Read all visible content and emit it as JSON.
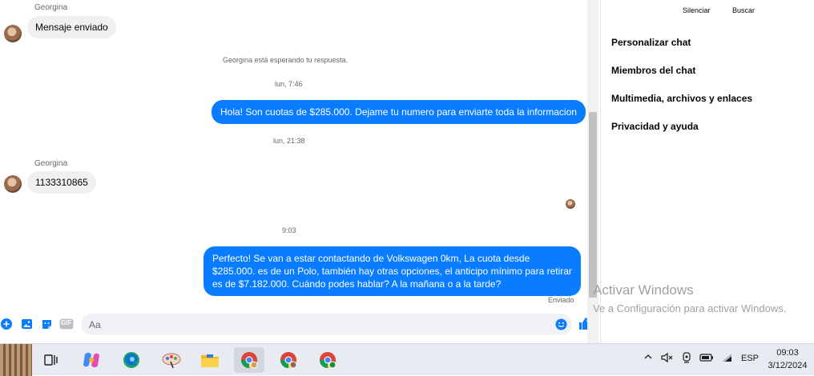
{
  "conversation": {
    "msg1": {
      "sender": "Georgina",
      "text": "Mensaje enviado"
    },
    "waiting_notice": "Georgina está esperando tu respuesta.",
    "time1": "lun, 7:46",
    "msg2": {
      "text": "Hola! Son cuotas de $285.000. Dejame tu numero para enviarte toda la informacion"
    },
    "time2": "lun, 21:38",
    "msg3": {
      "sender": "Georgina",
      "text": "1133310865"
    },
    "time3": "9:03",
    "msg4": {
      "text": "Perfecto!  Se van a estar contactando de Volkswagen 0km, La cuota desde $285.000. es de un Polo, también hay otras opciones, el anticipo mínimo para retirar es de $7.182.000. Cuándo podes hablar? A la mañana o a la tarde?"
    },
    "delivery_status": "Enviado"
  },
  "composer": {
    "placeholder": "Aa",
    "gif_label": "GIF"
  },
  "sidebar": {
    "actions": [
      "Silenciar",
      "Buscar"
    ],
    "items": [
      "Personalizar chat",
      "Miembros del chat",
      "Multimedia, archivos y enlaces",
      "Privacidad y ayuda"
    ]
  },
  "watermark": {
    "title": "Activar Windows",
    "subtitle": "Ve a Configuración para activar Windows."
  },
  "taskbar": {
    "apps": [
      "Files",
      "Task View",
      "Copilot",
      "Edge",
      "Paint",
      "File Explorer",
      "Chrome",
      "Chrome",
      "Chrome"
    ],
    "language": "ESP",
    "time": "09:03",
    "date": "3/12/2024"
  },
  "colors": {
    "accent": "#0a7cff",
    "incoming_bubble": "#f0f0f0"
  }
}
